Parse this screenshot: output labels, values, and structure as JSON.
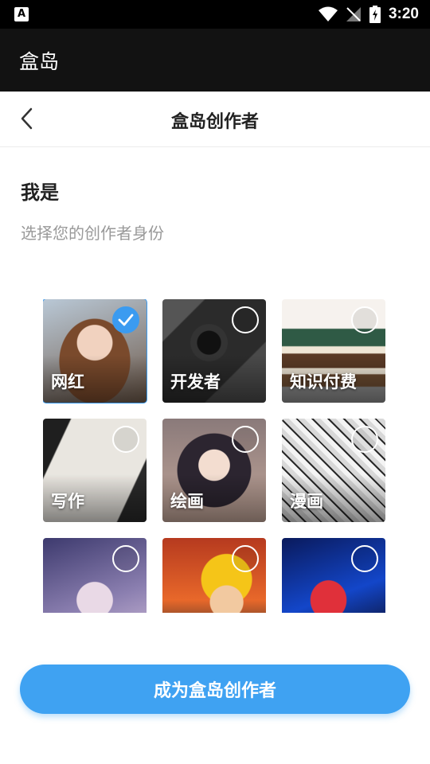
{
  "status_bar": {
    "time": "3:20",
    "left_badge": "A"
  },
  "app_bar": {
    "title": "盒岛"
  },
  "header": {
    "title": "盒岛创作者"
  },
  "intro": {
    "title": "我是",
    "subtitle": "选择您的创作者身份"
  },
  "categories": [
    {
      "label": "网红",
      "selected": true
    },
    {
      "label": "开发者",
      "selected": false
    },
    {
      "label": "知识付费",
      "selected": false
    },
    {
      "label": "写作",
      "selected": false
    },
    {
      "label": "绘画",
      "selected": false
    },
    {
      "label": "漫画",
      "selected": false
    },
    {
      "label": "",
      "selected": false
    },
    {
      "label": "",
      "selected": false
    },
    {
      "label": "",
      "selected": false
    }
  ],
  "cta": {
    "label": "成为盒岛创作者"
  },
  "colors": {
    "accent": "#3fa2f2",
    "selected_outline": "#3b9bf0",
    "app_bar_bg": "#121212"
  }
}
